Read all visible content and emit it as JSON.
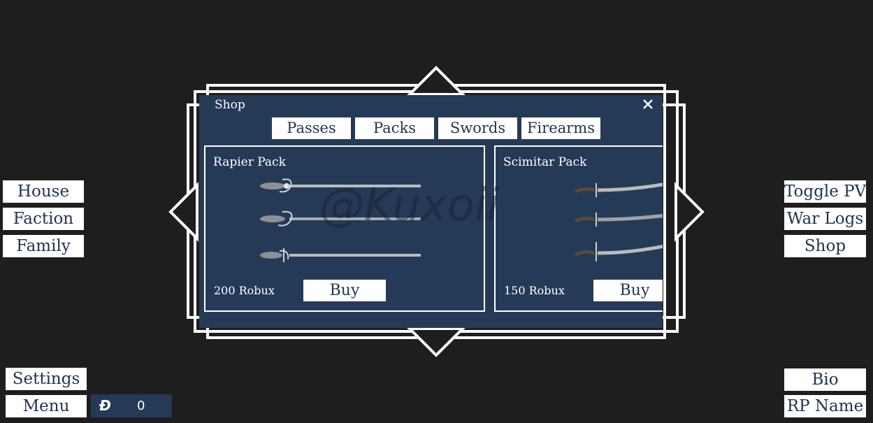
{
  "left_menu": {
    "house": "House",
    "faction": "Faction",
    "family": "Family",
    "settings": "Settings",
    "menu": "Menu"
  },
  "right_menu": {
    "toggle_pvp": "Toggle PVP",
    "war_logs": "War Logs",
    "shop": "Shop",
    "bio": "Bio",
    "rp_name": "RP Name"
  },
  "currency": {
    "icon": "Ð",
    "value": "0"
  },
  "shop": {
    "title": "Shop",
    "close_icon": "close-icon",
    "tabs": [
      "Passes",
      "Packs",
      "Swords",
      "Firearms"
    ],
    "items": [
      {
        "name": "Rapier Pack",
        "price": "200 Robux",
        "buy": "Buy"
      },
      {
        "name": "Scimitar Pack",
        "price": "150 Robux",
        "buy": "Buy"
      }
    ],
    "watermark": "@Kuxoii"
  },
  "colors": {
    "background": "#1e1e1e",
    "panel": "#253a57",
    "button_bg": "#ffffff",
    "button_text": "#1f3350"
  }
}
